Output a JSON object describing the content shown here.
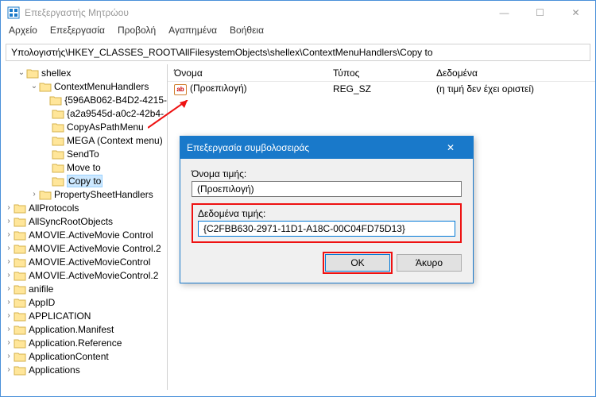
{
  "window": {
    "title": "Επεξεργαστής Μητρώου",
    "min": "—",
    "max": "☐",
    "close": "✕"
  },
  "menu": {
    "file": "Αρχείο",
    "edit": "Επεξεργασία",
    "view": "Προβολή",
    "favorites": "Αγαπημένα",
    "help": "Βοήθεια"
  },
  "address": "Υπολογιστής\\HKEY_CLASSES_ROOT\\AllFilesystemObjects\\shellex\\ContextMenuHandlers\\Copy to",
  "tree": {
    "root": "shellex",
    "handlers": "ContextMenuHandlers",
    "items": [
      "{596AB062-B4D2-4215-",
      "{a2a9545d-a0c2-42b4-",
      "CopyAsPathMenu",
      "MEGA (Context menu)",
      "SendTo",
      "Move to",
      "Copy to"
    ],
    "psh": "PropertySheetHandlers",
    "others": [
      "AllProtocols",
      "AllSyncRootObjects",
      "AMOVIE.ActiveMovie Control",
      "AMOVIE.ActiveMovie Control.2",
      "AMOVIE.ActiveMovieControl",
      "AMOVIE.ActiveMovieControl.2",
      "anifile",
      "AppID",
      "APPLICATION",
      "Application.Manifest",
      "Application.Reference",
      "ApplicationContent",
      "Applications"
    ]
  },
  "list": {
    "h1": "Όνομα",
    "h2": "Τύπος",
    "h3": "Δεδομένα",
    "row": {
      "icon": "ab",
      "name": "(Προεπιλογή)",
      "type": "REG_SZ",
      "data": "(η τιμή δεν έχει οριστεί)"
    }
  },
  "dialog": {
    "title": "Επεξεργασία συμβολοσειράς",
    "close": "✕",
    "name_label": "Όνομα τιμής:",
    "name_value": "(Προεπιλογή)",
    "data_label": "Δεδομένα τιμής:",
    "data_value": "{C2FBB630-2971-11D1-A18C-00C04FD75D13}",
    "ok": "OK",
    "cancel": "Άκυρο"
  }
}
